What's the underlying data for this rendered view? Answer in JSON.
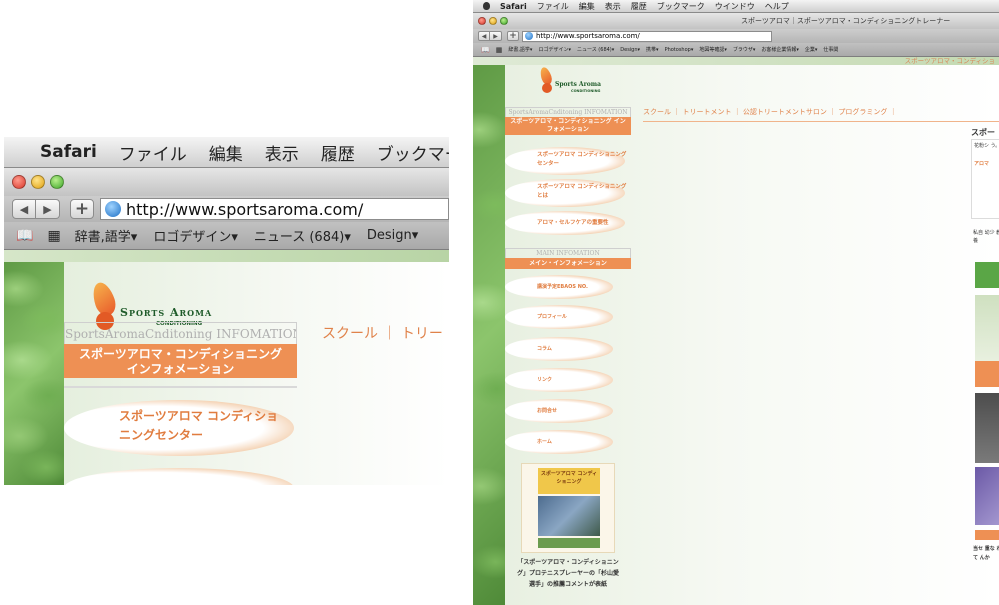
{
  "menubar": {
    "app_name": "Safari",
    "items": [
      "ファイル",
      "編集",
      "表示",
      "履歴",
      "ブックマーク",
      "ウインドウ",
      "ヘルプ"
    ]
  },
  "window": {
    "title": "スポーツアロマ｜スポーツアロマ・コンディショニングトレーナー"
  },
  "toolbar": {
    "back_label": "◀",
    "forward_label": "▶",
    "add_label": "+",
    "url": "http://www.sportsaroma.com/",
    "url_full": "http://www.sportsaroma.com/"
  },
  "bookmarks": {
    "zoom_items": [
      "辞書,語学▾",
      "ロゴデザイン▾",
      "ニュース (684)▾",
      "Design▾"
    ],
    "full_items": [
      "辞書,語学▾",
      "ロゴデザイン▾",
      "ニュース (684)▾",
      "Design▾",
      "携帯▾",
      "Photoshop▾",
      "地図等確認▾",
      "ブラウザ▾",
      "お客様企業情報▾",
      "企業▾",
      "仕事関"
    ]
  },
  "site": {
    "logo_title": "Sports Aroma",
    "logo_sub": "CONDITIONING",
    "header_tagline": "スポーツアロマ・コンディショ",
    "info_en": "SportsAromaCnditoning INFOMATION",
    "info_jp": "スポーツアロマ・コンディショニング インフォメーション",
    "top_nav_zoom": "スクール ｜ トリー",
    "top_nav_full": "スクール ｜ トリートメント ｜ 公認トリートメントサロン ｜ プログラミング ｜",
    "section_nav": [
      "スポーツアロマ コンディショニングセンター",
      "スポーツアロマ コンディショニングとは",
      "アロマ・セルフケアの重要性"
    ],
    "main_info_en": "MAIN INFOMATION",
    "main_info_jp": "メイン・インフォメーション",
    "main_nav": [
      "講演予定EBAOS NO.",
      "プロフィール",
      "コラム",
      "リンク",
      "お問合せ",
      "ホーム"
    ],
    "book_title": "スポーツアロマ コンディショニング",
    "book_caption": "「スポーツアロマ・コンディショニング」プロテニスプレーヤーの「杉山愛選手」の推薦コメントが表紙",
    "right_heading": "スポー",
    "right_snippet_1": "花粉シ う。",
    "right_snippet_2": "アロマ",
    "right_snippet_3": "私自 幼少 教養",
    "right_snippet_4": "当セ 重な れて んか"
  },
  "colors": {
    "accent_orange": "#ee9054",
    "nav_text": "#e07c3f",
    "leaf_green": "#6fae52"
  }
}
